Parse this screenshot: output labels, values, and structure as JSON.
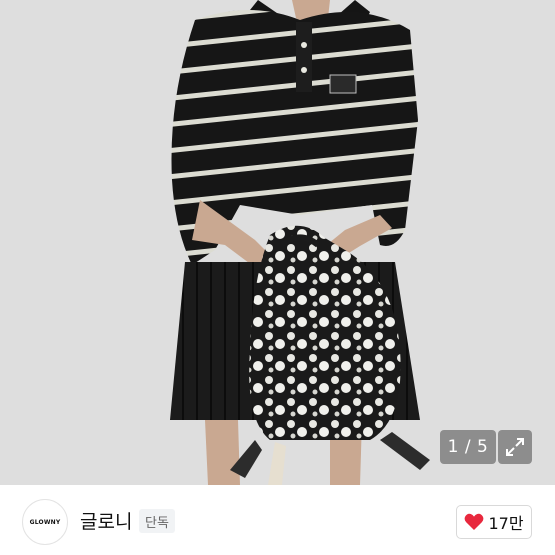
{
  "gallery": {
    "counter_text": "1 / 5",
    "expand_icon": "expand-arrows-icon"
  },
  "brand": {
    "logo_text": "GLOWNY",
    "name": "글로니",
    "badge": "단독"
  },
  "like": {
    "icon": "heart-icon",
    "count": "17만",
    "heart_color": "#e8283d"
  }
}
